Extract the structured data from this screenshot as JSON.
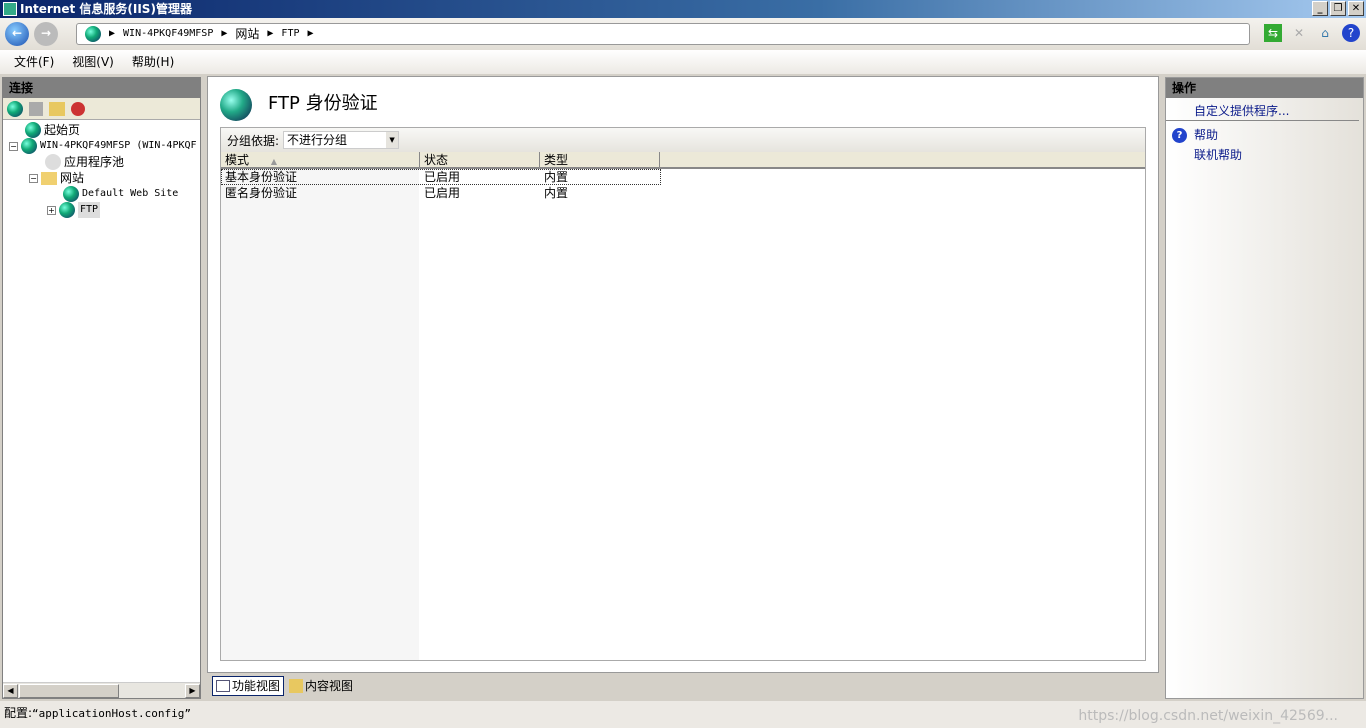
{
  "window": {
    "title": "Internet 信息服务(IIS)管理器",
    "minimize": "_",
    "restore": "❐",
    "close": "✕"
  },
  "address": {
    "segments": [
      "WIN-4PKQF49MFSP",
      "网站",
      "FTP"
    ],
    "separator": "▶"
  },
  "menu": [
    "文件(F)",
    "视图(V)",
    "帮助(H)"
  ],
  "connections": {
    "title": "连接",
    "tree": [
      {
        "label": "起始页",
        "icon": "start-page-icon"
      },
      {
        "label": "WIN-4PKQF49MFSP (WIN-4PKQF",
        "icon": "server-icon",
        "expander": "−"
      },
      {
        "label": "应用程序池",
        "icon": "app-pool-icon"
      },
      {
        "label": "网站",
        "icon": "sites-folder-icon",
        "expander": "−"
      },
      {
        "label": "Default Web Site",
        "icon": "globe-icon"
      },
      {
        "label": "FTP",
        "icon": "globe-icon",
        "expander": "+",
        "selected": true
      }
    ]
  },
  "main": {
    "title": "FTP 身份验证",
    "group_by_label": "分组依据:",
    "group_by_value": "不进行分组",
    "columns": [
      "模式",
      "状态",
      "类型"
    ],
    "sort_indicator": "▲",
    "rows": [
      [
        "基本身份验证",
        "已启用",
        "内置"
      ],
      [
        "匿名身份验证",
        "已启用",
        "内置"
      ]
    ]
  },
  "view_tabs": [
    "功能视图",
    "内容视图"
  ],
  "actions": {
    "title": "操作",
    "items": [
      "自定义提供程序...",
      "帮助",
      "联机帮助"
    ]
  },
  "status": {
    "label": "配置:",
    "value": "“applicationHost.config”"
  },
  "watermark": "https://blog.csdn.net/weixin_42569..."
}
